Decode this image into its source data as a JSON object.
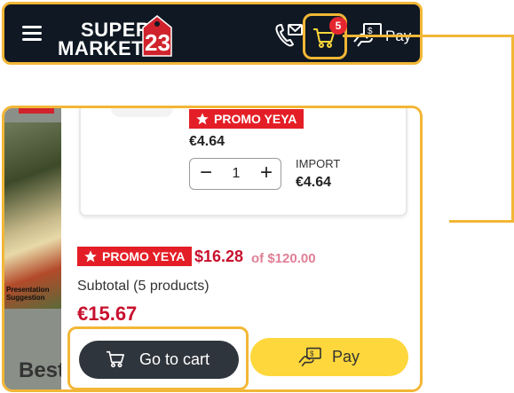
{
  "header": {
    "logo": {
      "line1": "SUPER",
      "line2": "MARKET",
      "number": "23"
    },
    "menu_icon": "hamburger-menu-icon",
    "contact_icon": "phone-envelope-icon",
    "cart": {
      "icon": "shopping-cart-icon",
      "badge_count": "5"
    },
    "pay": {
      "icon": "hand-money-icon",
      "label": "Pay"
    }
  },
  "background": {
    "caption_line1": "Presentation",
    "caption_line2": "Suggestion",
    "heading": "Best"
  },
  "cart_item": {
    "promo_label": "PROMO YEYA",
    "unit_price": "€4.64",
    "quantity": "1",
    "import_label": "IMPORT",
    "import_value": "€4.64"
  },
  "summary": {
    "promo_label": "PROMO YEYA",
    "promo_price": "$16.28",
    "promo_of": "of $120.00",
    "subtotal_label": "Subtotal (5 products)",
    "subtotal_value": "€15.67"
  },
  "actions": {
    "go_to_cart_label": "Go to cart",
    "pay_label": "Pay"
  },
  "colors": {
    "header_bg": "#0f1823",
    "highlight": "#f2b736",
    "promo_red": "#e41e26",
    "price_red": "#c8102e",
    "dark_button": "#2f353c",
    "pay_yellow": "#fdd73b"
  }
}
